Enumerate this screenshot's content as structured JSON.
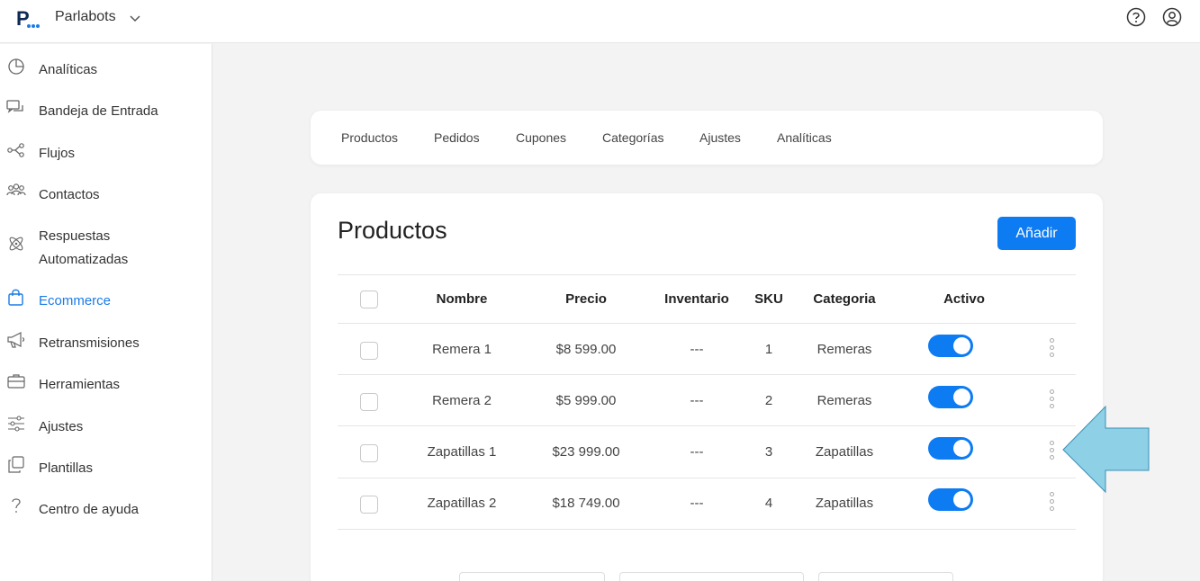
{
  "workspace": {
    "name": "Parlabots",
    "logo_icon": "parlabots-logo",
    "chevron_icon": "chevron-down-icon"
  },
  "topbar": {
    "help_icon": "help-icon",
    "user_icon": "user-icon"
  },
  "sidebar": {
    "items": [
      {
        "label": "Analíticas",
        "icon": "pie-chart-icon",
        "active": false
      },
      {
        "label": "Bandeja de Entrada",
        "icon": "chat-icon",
        "active": false
      },
      {
        "label": "Flujos",
        "icon": "flow-icon",
        "active": false
      },
      {
        "label": "Contactos",
        "icon": "contacts-icon",
        "active": false
      },
      {
        "label": "Respuestas",
        "label2": "Automatizadas",
        "icon": "atom-icon",
        "active": false
      },
      {
        "label": "Ecommerce",
        "icon": "shopping-bag-icon",
        "active": true
      },
      {
        "label": "Retransmisiones",
        "icon": "megaphone-icon",
        "active": false
      },
      {
        "label": "Herramientas",
        "icon": "toolbox-icon",
        "active": false
      },
      {
        "label": "Ajustes",
        "icon": "sliders-icon",
        "active": false
      },
      {
        "label": "Plantillas",
        "icon": "copy-icon",
        "active": false
      },
      {
        "label": "Centro de ayuda",
        "icon": "question-icon",
        "active": false
      }
    ]
  },
  "tabs": [
    "Productos",
    "Pedidos",
    "Cupones",
    "Categorías",
    "Ajustes",
    "Analíticas"
  ],
  "main": {
    "title": "Productos",
    "add_button": "Añadir",
    "columns": [
      "Nombre",
      "Precio",
      "Inventario",
      "SKU",
      "Categoria",
      "Activo"
    ],
    "rows": [
      {
        "nombre": "Remera 1",
        "precio": "$8 599.00",
        "inventario": "---",
        "sku": "1",
        "categoria": "Remeras",
        "activo": true
      },
      {
        "nombre": "Remera 2",
        "precio": "$5 999.00",
        "inventario": "---",
        "sku": "2",
        "categoria": "Remeras",
        "activo": true
      },
      {
        "nombre": "Zapatillas 1",
        "precio": "$23 999.00",
        "inventario": "---",
        "sku": "3",
        "categoria": "Zapatillas",
        "activo": true
      },
      {
        "nombre": "Zapatillas 2",
        "precio": "$18 749.00",
        "inventario": "---",
        "sku": "4",
        "categoria": "Zapatillas",
        "activo": true
      }
    ]
  },
  "colors": {
    "accent": "#0d7bf2",
    "active_text": "#1a7be6",
    "arrow_fill": "#8ed0e6"
  }
}
